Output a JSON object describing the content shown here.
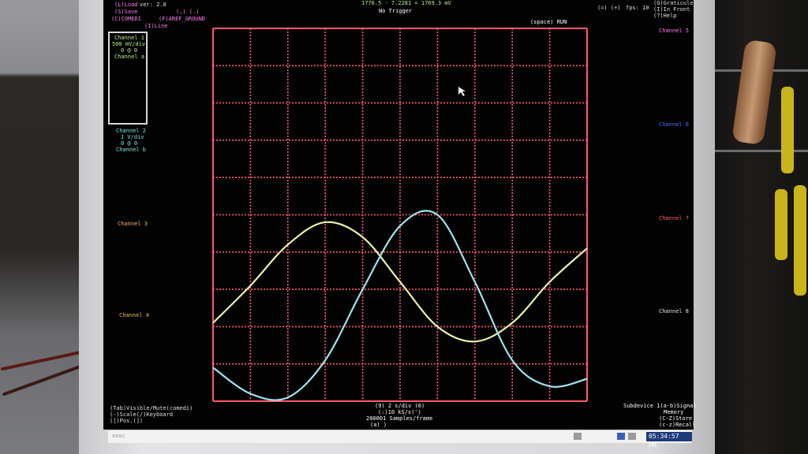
{
  "app": {
    "title_readout": "1776.5 - 7.2281 = 1769.3 mV",
    "trigger_status": "No Trigger",
    "zoom_hint": "(=) (+)",
    "fps_label": "fps: 10",
    "run_hint": "(space) RUN"
  },
  "top_left_menu": {
    "item_load": "(L)Load",
    "version": "ver: 2.0",
    "item_save": "(S)Save",
    "item_bracket": "(,) (.)",
    "item_comedi": "(C)COMEDI",
    "item_aref": "(F)AREF_GROUND",
    "item_line": "(I)Line"
  },
  "top_right_menu": {
    "item_graticule": "(G)Graticule",
    "item_infront": "(I)In Front",
    "item_help": "(?)Help"
  },
  "channel_panel": {
    "ch1_name": "Channel 1",
    "ch1_scale": "500 mV/div",
    "ch1_offset": "0 @ 0",
    "ch1_source": "Channel a",
    "ch2_name": "Channel 2",
    "ch2_scale": "1 V/div",
    "ch2_offset": "0 @ 0",
    "ch2_source": "Channel b",
    "ch3_name": "Channel 3",
    "ch4_name": "Channel 4"
  },
  "right_channels": {
    "ch5": "Channel 5",
    "ch6": "Channel 6",
    "ch7": "Channel 7",
    "ch8": "Channel 8"
  },
  "bottom_left": {
    "line1": "(Tab)Visible/Mute(comedi)",
    "line2": "(-)Scale(/)Keyboard",
    "line3": "([)Pos.(])"
  },
  "bottom_center": {
    "timebase": "(9)   2 s/div   (0)",
    "sample_rate": "(:)10 kS/s(')",
    "samples": "200001 Samples/frame",
    "brackets": "(a)                       )"
  },
  "bottom_right": {
    "subdevice": "Subdevice 1(a-b)Signal",
    "memory": "Memory",
    "store": "(C-Z)Store",
    "recall": "(c-z)Recall"
  },
  "taskbar": {
    "start_label": "xosc",
    "clock": "05:34:57 PM"
  },
  "colors": {
    "grid": "#ff5a6e",
    "trace_ch1": "#e8f1a6",
    "trace_ch2": "#9fe4f0",
    "text_cyan": "#7fe6e6",
    "text_green": "#b4f08c",
    "text_magenta": "#ff7ee8",
    "text_blue": "#4a6aff",
    "text_red": "#ff5a6e",
    "text_orange": "#f5b36a"
  },
  "chart_data": {
    "type": "line",
    "divisions": {
      "x": 10,
      "y": 10
    },
    "series": [
      {
        "name": "Channel 1",
        "y_divs": [
          7.9,
          6.9,
          5.8,
          5.2,
          5.6,
          6.8,
          8.0,
          8.4,
          7.9,
          6.8,
          5.9
        ]
      },
      {
        "name": "Channel 2",
        "y_divs": [
          9.1,
          9.8,
          9.9,
          8.9,
          7.0,
          5.3,
          5.0,
          6.8,
          8.9,
          9.6,
          9.4
        ]
      }
    ]
  }
}
